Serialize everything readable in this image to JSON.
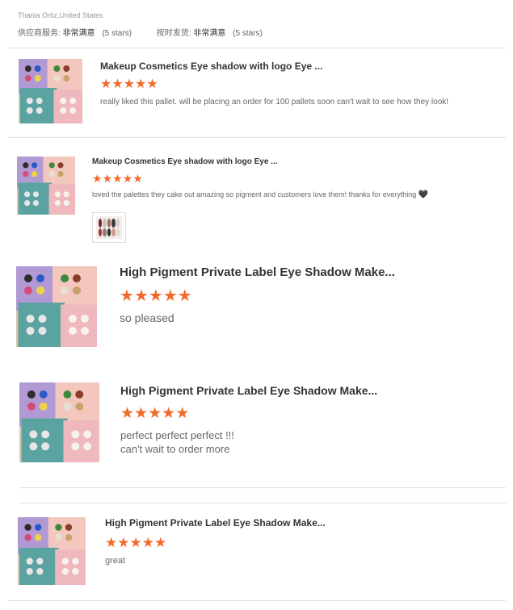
{
  "reviewer": "Thania Ortiz,United States",
  "supplier": {
    "service_label": "供应商服务:",
    "service_value": "非常满意",
    "service_stars": "(5 stars)",
    "shipping_label": "按时发货:",
    "shipping_value": "非常满意",
    "shipping_stars": "(5 stars)"
  },
  "reviews": [
    {
      "title": "Makeup Cosmetics Eye shadow with logo Eye ...",
      "rating": 5,
      "comment": "really liked this pallet. will be placing an order for 100 pallets soon can't wait to see how they look!"
    },
    {
      "title": "Makeup Cosmetics Eye shadow with logo Eye ...",
      "rating": 5,
      "comment": "loved the palettes they cake out amazing so pigment and customers love them! thanks for everything",
      "comment_icon": "heart-icon"
    },
    {
      "title": "High Pigment Private Label Eye Shadow Make...",
      "rating": 5,
      "comment": "so pleased"
    },
    {
      "title": "High Pigment Private Label Eye Shadow Make...",
      "rating": 5,
      "comment_line1": "perfect perfect perfect !!!",
      "comment_line2": "can't wait to order more"
    },
    {
      "title": "High Pigment Private Label Eye Shadow Make...",
      "rating": 5,
      "comment": "great"
    }
  ],
  "colors": {
    "star": "#f2692a",
    "divider": "#e0e0e0",
    "text_muted": "#999999"
  }
}
